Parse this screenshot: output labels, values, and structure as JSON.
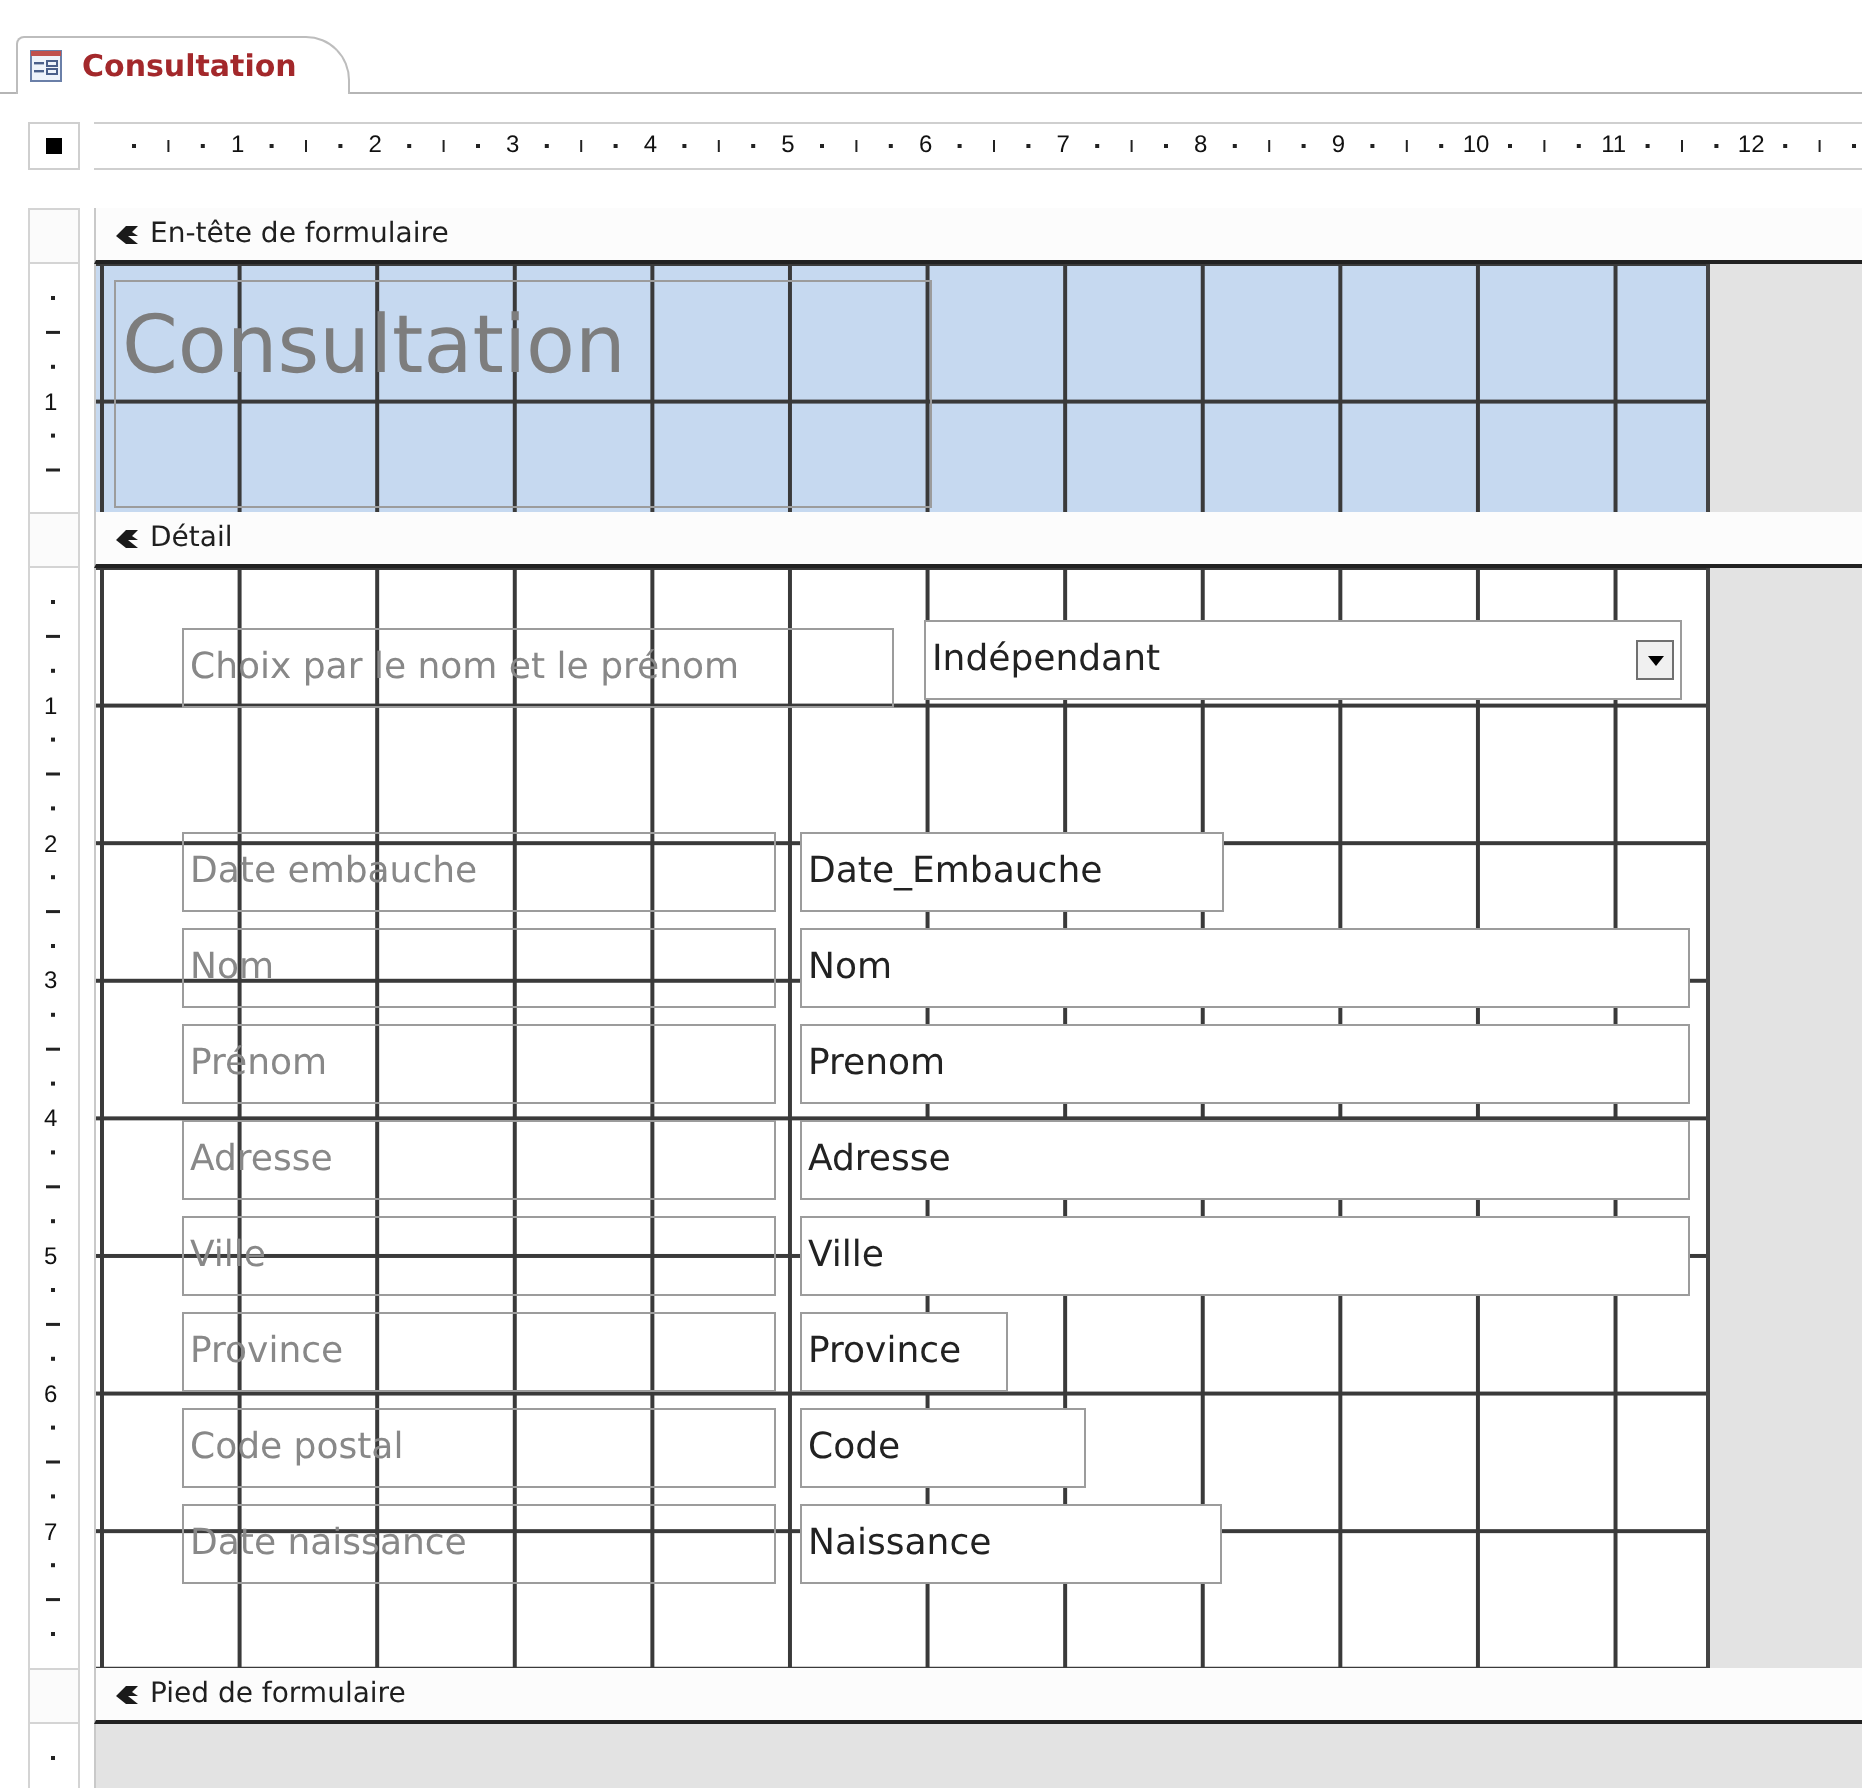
{
  "tab": {
    "title": "Consultation",
    "selected": true
  },
  "ruler": {
    "marks": [
      "1",
      "2",
      "3",
      "4",
      "5",
      "6",
      "7",
      "8",
      "9",
      "10",
      "11",
      "12"
    ]
  },
  "sections": [
    {
      "kind": "header",
      "title": "En-tête de formulaire",
      "ruler_marks": [
        "1"
      ],
      "title_label": "Consultation"
    },
    {
      "kind": "detail",
      "title": "Détail",
      "ruler_marks": [
        "1",
        "2",
        "3",
        "4",
        "5",
        "6",
        "7"
      ],
      "choice": {
        "label": "Choix par le nom et le prénom",
        "value": "Indépendant"
      },
      "fields": [
        {
          "label": "Date embauche",
          "value": "Date_Embauche"
        },
        {
          "label": "Nom",
          "value": "Nom"
        },
        {
          "label": "Prénom",
          "value": "Prenom"
        },
        {
          "label": "Adresse",
          "value": "Adresse"
        },
        {
          "label": "Ville",
          "value": "Ville"
        },
        {
          "label": "Province",
          "value": "Province"
        },
        {
          "label": "Code postal",
          "value": "Code"
        },
        {
          "label": "Date naissance",
          "value": "Naissance"
        }
      ]
    },
    {
      "kind": "footer",
      "title": "Pied de formulaire"
    }
  ]
}
